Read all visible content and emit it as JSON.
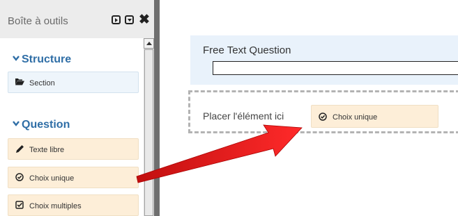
{
  "toolbox": {
    "title": "Boîte à outils",
    "controls": [
      "expand-icon",
      "collapse-icon",
      "close-icon"
    ],
    "close_glyph": "✖",
    "sections": [
      {
        "title": "Structure",
        "items": [
          {
            "label": "Section",
            "icon": "folder-open-icon"
          }
        ]
      },
      {
        "title": "Question",
        "items": [
          {
            "label": "Texte libre",
            "icon": "pencil-icon"
          },
          {
            "label": "Choix unique",
            "icon": "radio-check-icon"
          },
          {
            "label": "Choix multiples",
            "icon": "checkbox-icon"
          }
        ]
      }
    ]
  },
  "canvas": {
    "question": {
      "title": "Free Text Question",
      "input_value": ""
    },
    "drop_zone": {
      "text": "Placer l'élément ici",
      "dragged_item": {
        "label": "Choix unique",
        "icon": "radio-check-icon"
      }
    }
  },
  "colors": {
    "accent": "#2f6ea6",
    "structure_item_bg": "#eef5fb",
    "question_item_bg": "#fdeed8",
    "question_box_bg": "#e9f2fb",
    "arrow": "#e31b1b"
  }
}
